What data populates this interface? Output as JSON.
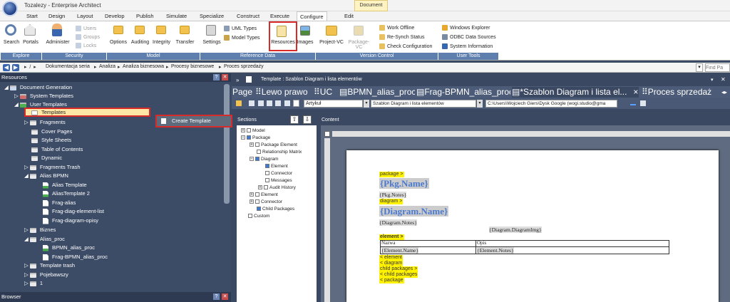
{
  "app": {
    "title": "Tozalezy - Enterprise Architect",
    "doc_context_tab": "Document"
  },
  "menu": [
    "Start",
    "Design",
    "Layout",
    "Develop",
    "Publish",
    "Simulate",
    "Specialize",
    "Construct",
    "Execute",
    "Configure",
    "Edit"
  ],
  "ribbon": {
    "search": "Search",
    "portals": "Portals",
    "administer": "Administer",
    "users": "Users",
    "groups": "Groups",
    "locks": "Locks",
    "options": "Options",
    "auditing": "Auditing",
    "integrity": "Integrity",
    "transfer": "Transfer",
    "settings": "Settings",
    "uml_types": "UML Types",
    "model_types": "Model Types",
    "resources": "Resources",
    "images": "Images",
    "project_vc": "Project-VC",
    "package_vc": "Package-VC",
    "work_offline": "Work Offline",
    "resync": "Re-Synch Status",
    "check_config": "Check Configuration",
    "windows_explorer": "Windows Explorer",
    "odbc": "ODBC Data Sources",
    "system_info": "System Information",
    "groups_labels": {
      "explore": "Explore",
      "security": "Security",
      "model": "Model",
      "reference": "Reference Data",
      "version": "Version Control",
      "user_tools": "User Tools"
    }
  },
  "navbar": {
    "path": [
      "Dokumentacja seria",
      "Analiza",
      "Analiza biznesowa",
      "Procesy biznesowe",
      "Proces sprzedaży"
    ],
    "find_placeholder": "Find Pa"
  },
  "left_panel": {
    "title": "Resources",
    "tree": {
      "doc_gen": "Document Generation",
      "system_templates": "System Templates",
      "user_templates": "User Templates",
      "templates": "Templates",
      "fragments": "Fragments",
      "cover_pages": "Cover Pages",
      "style_sheets": "Style Sheets",
      "toc": "Table of Contents",
      "dynamic": "Dynamic",
      "fragments_trash": "Fragments Trash",
      "alias_bpmn": "Alias BPMN",
      "alias_template": "Alias Template",
      "alias_template2": "AliasTemplate 2",
      "frag_alias": "Frag-alias",
      "frag_diag_el": "Frag-diag-element-list",
      "frag_diag_opisy": "Frag-diagram-opisy",
      "biznes": "Biznes",
      "alias_proc": "Alias_proc",
      "bpmn_alias_proc": "BPMN_alias_proc",
      "frag_bpmn_alias_proc": "Frag-BPMN_alias_proc",
      "template_trash": "Template trash",
      "pojebawszy": "Pojebawszy",
      "one": "1"
    },
    "context_menu": "Create Template",
    "browser": "Browser"
  },
  "right_panel": {
    "header": "Template : Szablon Diagram i lista elementów",
    "tabs": [
      "Page",
      "Lewo prawo",
      "UC",
      "BPMN_alias_proc",
      "Frag-BPMN_alias_proc",
      "*Szablon Diagram i lista el...",
      "Proces sprzedaż"
    ],
    "style_value": "Artykuł",
    "template_value": "Szablon Diagram i lista elementów",
    "path_value": "C:\\Users\\Wojciech Giers\\Dysk Google (wogi.studio@gma",
    "sections_label": "Sections",
    "content_label": "Content",
    "sections": {
      "model": "Model",
      "package": "Package",
      "package_element": "Package Element",
      "relationship_matrix": "Relationship Matrix",
      "diagram": "Diagram",
      "element": "Element",
      "connector": "Connector",
      "messages": "Messages",
      "audit_history": "Audit History",
      "element2": "Element",
      "connector2": "Connector",
      "child_packages": "Child Packages",
      "custom": "Custom"
    }
  },
  "doc": {
    "package_open": "package >",
    "pkg_name": "{Pkg.Name}",
    "pkg_notes": "{Pkg.Notes}",
    "diagram_open": "diagram >",
    "diagram_name": "{Diagram.Name}",
    "diagram_notes": "{Diagram.Notes}",
    "diagram_img": "{Diagram.DiagramImg}",
    "element_open": "element >",
    "col_nazwa": "Nazwa",
    "col_opis": "Opis",
    "el_name": "{Element.Name}",
    "el_notes": "{Element.Notes}",
    "element_close": "< element",
    "diagram_close": "< diagram",
    "child_open": "child packages >",
    "child_close": "< child packages",
    "package_close": "< package"
  },
  "colors": {
    "accent": "#5e7fae",
    "highlight": "#d92a2a",
    "selection": "#ffe8a6",
    "tag": "#fff200"
  }
}
